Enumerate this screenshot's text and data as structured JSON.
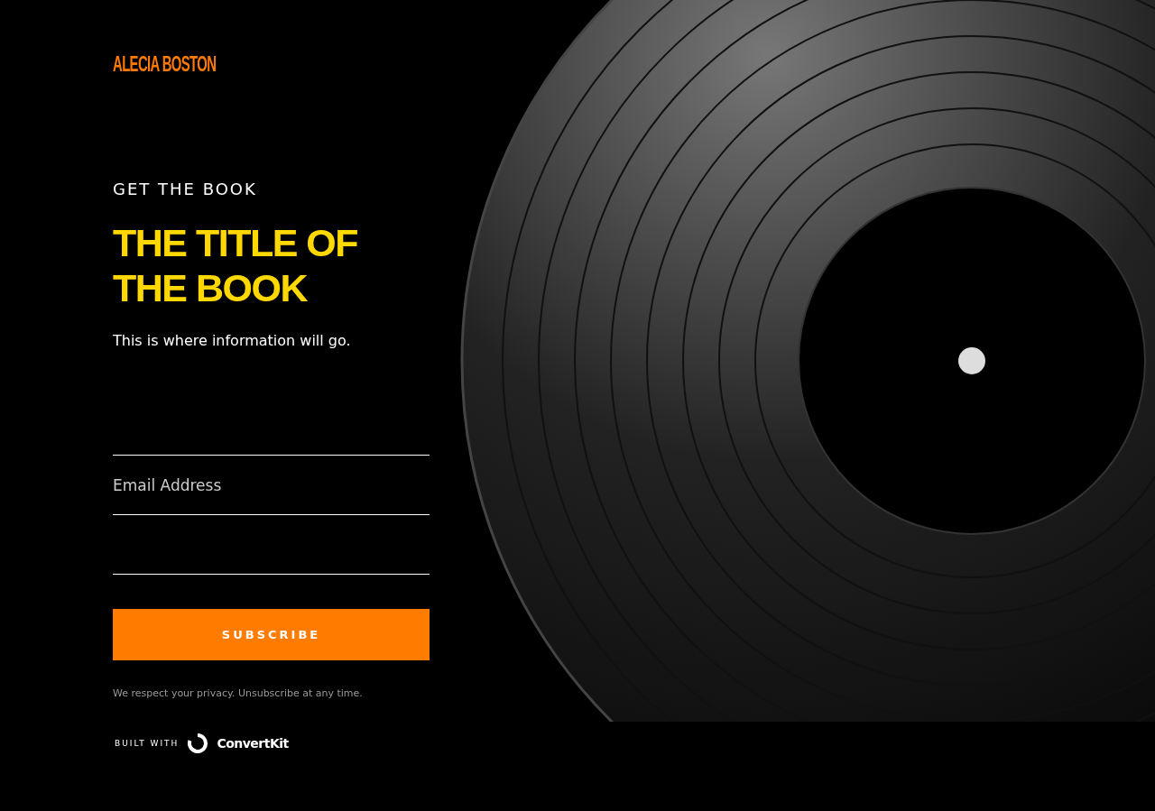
{
  "brand": "ALECIA BOSTON",
  "eyebrow": "GET THE BOOK",
  "title": "THE TITLE OF THE BOOK",
  "description": "This is where information will go.",
  "email_field": {
    "placeholder": "Email Address"
  },
  "button": "SUBSCRIBE",
  "privacy": "We respect your privacy. Unsubscribe at any time.",
  "footer": {
    "built_with": "BUILT WITH",
    "provider": "ConvertKit"
  }
}
